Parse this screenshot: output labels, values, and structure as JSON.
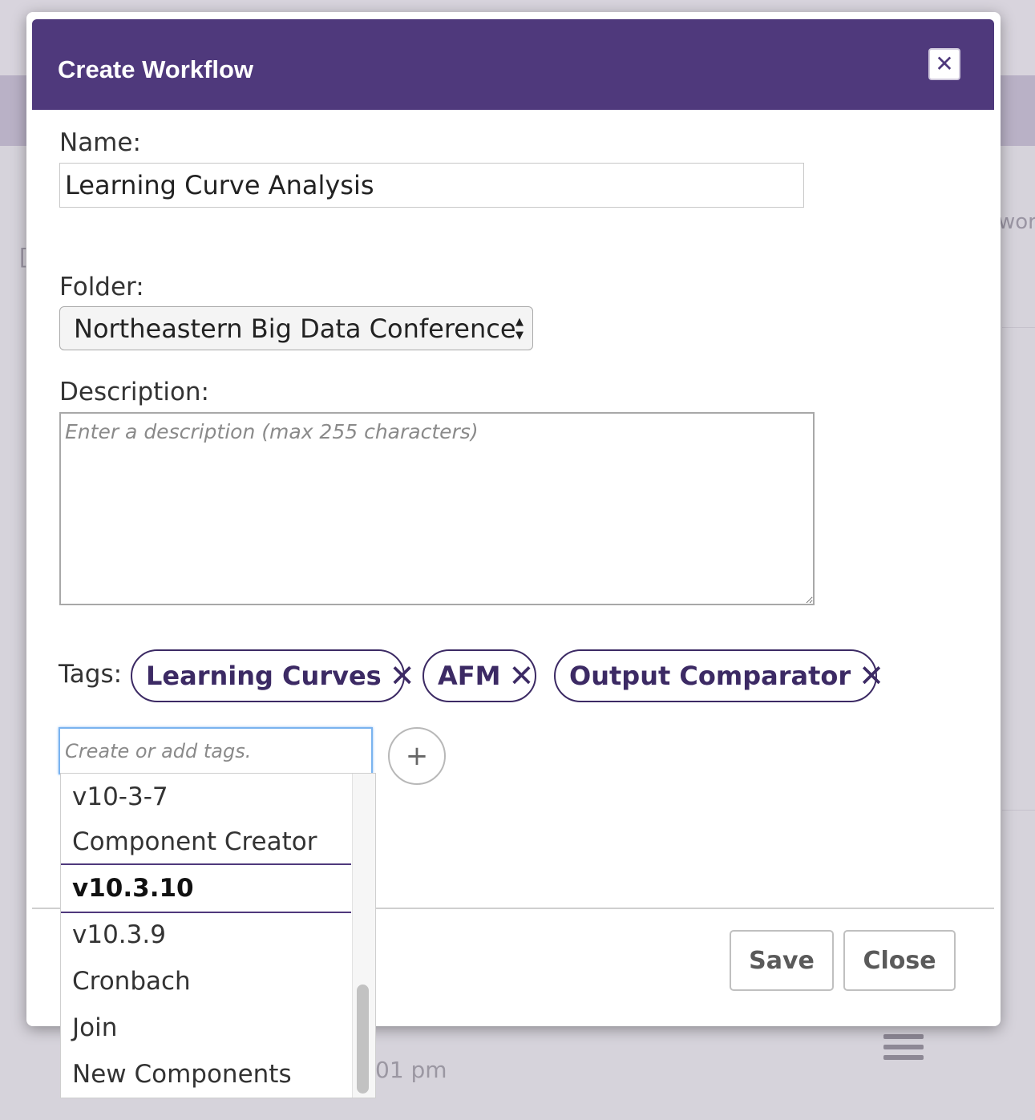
{
  "background": {
    "side_text": "wor",
    "bracket": "[",
    "time_text": "01 pm"
  },
  "modal": {
    "title": "Create Workflow",
    "close_icon": "close-icon",
    "name_label": "Name:",
    "name_value": "Learning Curve Analysis",
    "folder_label": "Folder:",
    "folder_value": "Northeastern Big Data Conference",
    "description_label": "Description:",
    "description_placeholder": "Enter a description (max 255 characters)",
    "tags_label": "Tags:",
    "tags": [
      {
        "label": "Learning Curves"
      },
      {
        "label": "AFM"
      },
      {
        "label": "Output Comparator"
      }
    ],
    "tag_input_placeholder": "Create or add tags.",
    "add_tag_symbol": "+",
    "save_label": "Save",
    "close_label": "Close"
  },
  "dropdown": {
    "items": [
      "v10-3-7",
      "Component Creator",
      "v10.3.10",
      "v10.3.9",
      "Cronbach",
      "Join",
      "New Components"
    ],
    "active": "v10.3.10"
  },
  "colors": {
    "header": "#4f397c",
    "tag_border": "#3c2a64",
    "focus": "#7ab3ef"
  }
}
